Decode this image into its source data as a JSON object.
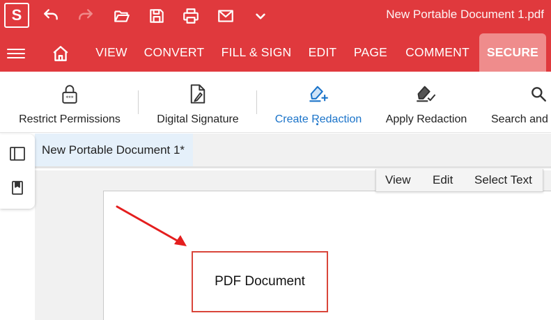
{
  "app": {
    "logo_letter": "S",
    "document_title": "New Portable Document 1.pdf",
    "accent_color": "#e0393d"
  },
  "quick_access": [
    {
      "name": "undo-icon"
    },
    {
      "name": "redo-icon"
    },
    {
      "name": "open-folder-icon"
    },
    {
      "name": "save-icon"
    },
    {
      "name": "print-icon"
    },
    {
      "name": "email-icon"
    },
    {
      "name": "chevron-down-icon"
    }
  ],
  "nav": {
    "tabs": [
      {
        "label": "VIEW"
      },
      {
        "label": "CONVERT"
      },
      {
        "label": "FILL & SIGN"
      },
      {
        "label": "EDIT"
      },
      {
        "label": "PAGE"
      },
      {
        "label": "COMMENT"
      },
      {
        "label": "SECURE"
      }
    ],
    "active_tab": "SECURE"
  },
  "ribbon": {
    "items": [
      {
        "label": "Restrict Permissions",
        "icon": "lock-icon"
      },
      {
        "label": "Digital Signature",
        "icon": "signature-icon"
      },
      {
        "label": "Create Redaction",
        "icon": "create-redaction-icon"
      },
      {
        "label": "Apply Redaction",
        "icon": "apply-redaction-icon"
      },
      {
        "label": "Search and R",
        "icon": "search-icon"
      }
    ]
  },
  "document_tab": {
    "label": "New Portable Document 1*"
  },
  "mode_bar": {
    "view": "View",
    "edit": "Edit",
    "select_text": "Select Text"
  },
  "page_content": {
    "text_box": "PDF Document"
  }
}
